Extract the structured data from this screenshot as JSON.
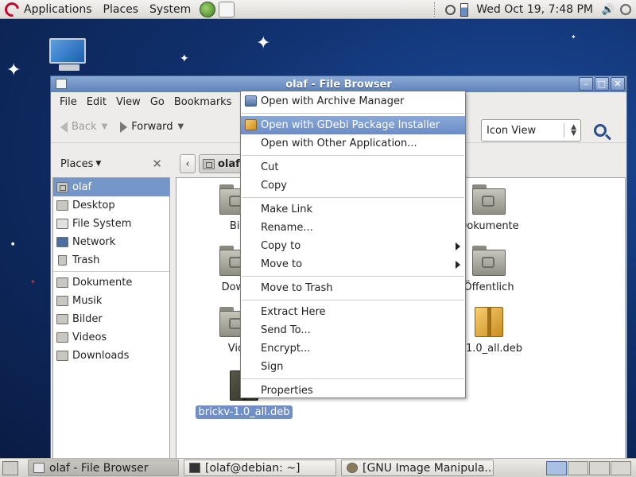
{
  "top_panel": {
    "menus": [
      "Applications",
      "Places",
      "System"
    ],
    "clock": "Wed Oct 19,  7:48 PM"
  },
  "window": {
    "title": "olaf - File Browser",
    "menubar": [
      "File",
      "Edit",
      "View",
      "Go",
      "Bookmarks"
    ],
    "toolbar": {
      "back_label": "Back",
      "forward_label": "Forward",
      "view_mode": "Icon View"
    },
    "sidebar": {
      "header": "Places",
      "items": [
        "olaf",
        "Desktop",
        "File System",
        "Network",
        "Trash"
      ],
      "bookmarks": [
        "Dokumente",
        "Musik",
        "Bilder",
        "Videos",
        "Downloads"
      ]
    },
    "path": {
      "current": "olaf"
    },
    "files": [
      {
        "label": "Bil",
        "type": "folder"
      },
      {
        "label": "Down",
        "type": "folder"
      },
      {
        "label": "Vid",
        "type": "folder"
      },
      {
        "label": "brickv-1.0_all.deb",
        "type": "package",
        "selected": true
      },
      {
        "label": "Dokumente",
        "type": "folder"
      },
      {
        "label": "Öffentlich",
        "type": "folder"
      },
      {
        "label": "d-1.0_all.deb",
        "type": "package"
      }
    ]
  },
  "context_menu": {
    "items": [
      {
        "label": "Open with Archive Manager",
        "icon": "archive-manager-icon"
      },
      {
        "label": "Open with GDebi Package Installer",
        "icon": "gdebi-icon",
        "highlighted": true
      },
      {
        "label": "Open with Other Application..."
      },
      {
        "label": "Cut"
      },
      {
        "label": "Copy"
      },
      {
        "label": "Make Link"
      },
      {
        "label": "Rename..."
      },
      {
        "label": "Copy to",
        "submenu": true
      },
      {
        "label": "Move to",
        "submenu": true
      },
      {
        "label": "Move to Trash"
      },
      {
        "label": "Extract Here"
      },
      {
        "label": "Send To..."
      },
      {
        "label": "Encrypt..."
      },
      {
        "label": "Sign"
      },
      {
        "label": "Properties"
      }
    ]
  },
  "taskbar": {
    "tasks": [
      "olaf - File Browser",
      "[olaf@debian: ~]",
      "[GNU Image Manipula..."
    ]
  },
  "colors": {
    "selection": "#7596c9",
    "titlebar": "#6f8fc6"
  }
}
